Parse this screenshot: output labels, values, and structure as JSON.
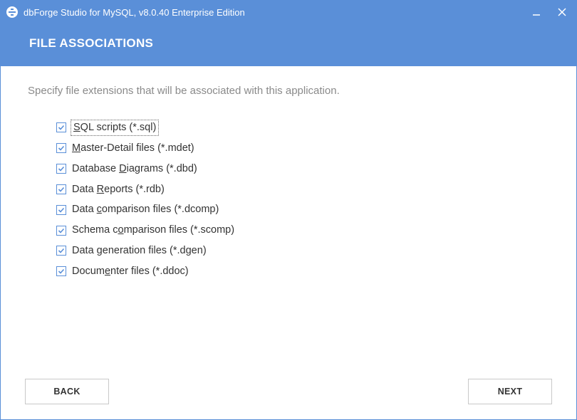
{
  "title": "dbForge Studio for MySQL, v8.0.40 Enterprise Edition",
  "header": "FILE ASSOCIATIONS",
  "description": "Specify file extensions that will be associated with this application.",
  "items": [
    {
      "pre": "",
      "u": "S",
      "post": "QL scripts (*.sql)",
      "checked": true,
      "focused": true
    },
    {
      "pre": "",
      "u": "M",
      "post": "aster-Detail files (*.mdet)",
      "checked": true,
      "focused": false
    },
    {
      "pre": "Database ",
      "u": "D",
      "post": "iagrams (*.dbd)",
      "checked": true,
      "focused": false
    },
    {
      "pre": "Data ",
      "u": "R",
      "post": "eports (*.rdb)",
      "checked": true,
      "focused": false
    },
    {
      "pre": "Data ",
      "u": "c",
      "post": "omparison files (*.dcomp)",
      "checked": true,
      "focused": false
    },
    {
      "pre": "Schema c",
      "u": "o",
      "post": "mparison files (*.scomp)",
      "checked": true,
      "focused": false
    },
    {
      "pre": "Data ",
      "u": "g",
      "post": "eneration files (*.dgen)",
      "checked": true,
      "focused": false
    },
    {
      "pre": "Docum",
      "u": "e",
      "post": "nter files (*.ddoc)",
      "checked": true,
      "focused": false
    }
  ],
  "buttons": {
    "back": "BACK",
    "next": "NEXT"
  }
}
